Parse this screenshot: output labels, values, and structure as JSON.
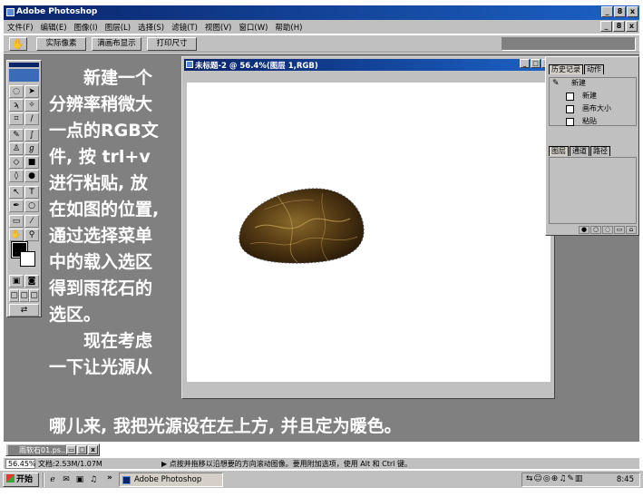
{
  "app": {
    "title": "Adobe Photoshop",
    "window_buttons": [
      "_",
      "8",
      "x"
    ]
  },
  "menu": {
    "items": [
      "文件(F)",
      "编辑(E)",
      "图像(I)",
      "图层(L)",
      "选择(S)",
      "滤镜(T)",
      "视图(V)",
      "窗口(W)",
      "帮助(H)"
    ],
    "doc_buttons": [
      "_",
      "8",
      "x"
    ]
  },
  "options_bar": {
    "btn_actual_pixels": "实际像素",
    "btn_fit_screen": "满画布显示",
    "btn_print_size": "打印尺寸"
  },
  "document": {
    "title": "未标题-2 @ 56.4%(图层 1,RGB)",
    "window_buttons": [
      "_",
      "□",
      "x"
    ]
  },
  "history_panel": {
    "tab_history": "历史记录",
    "tab_actions": "动作",
    "snapshot_label": "新建",
    "rows": [
      "新建",
      "画布大小",
      "粘贴"
    ]
  },
  "layers_panel": {
    "tab_layers": "图层",
    "tab_channels": "通道",
    "tab_paths": "路径"
  },
  "instruction": {
    "lines": [
      "新建一个",
      "分辨率稍微大",
      "一点的RGB文",
      "件, 按 trl+v",
      "进行粘贴, 放",
      "在如图的位置,",
      "通过选择菜单",
      "中的载入选区",
      "得到雨花石的",
      "选区。",
      "现在考虑",
      "一下让光源从"
    ],
    "bottom_line": "哪儿来, 我把光源设在左上方, 并且定为暖色。"
  },
  "minimized_doc": {
    "title": "雨软石01.ps..."
  },
  "status_bar": {
    "zoom": "56.45%",
    "doc_size": "文档:2.53M/1.07M",
    "hint": "点按并拖移以沿想要的方向滚动图像。要用附加选项，使用 Alt 和 Ctrl 键。"
  },
  "taskbar": {
    "start_label": "开始",
    "more": "»",
    "task_label": "Adobe Photoshop",
    "clock": "8:45"
  }
}
